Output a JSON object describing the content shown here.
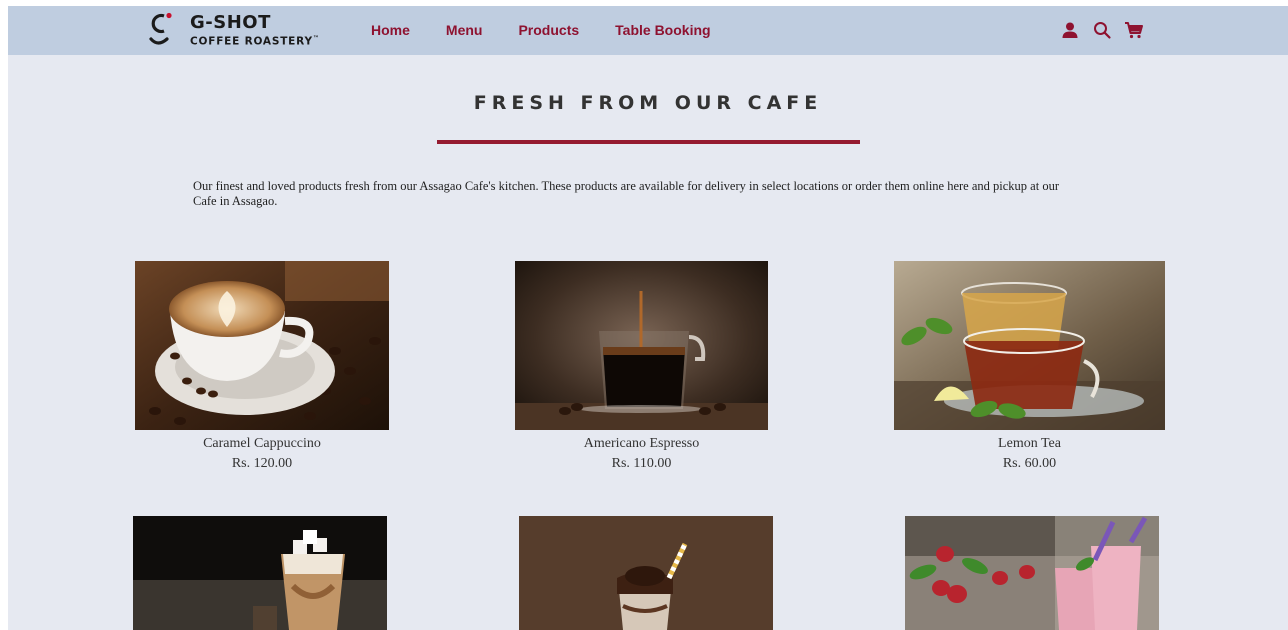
{
  "brand": {
    "name_line1": "G-SHOT",
    "name_line2": "COFFEE ROASTERY",
    "trademark": "™"
  },
  "nav": {
    "links": [
      "Home",
      "Menu",
      "Products",
      "Table Booking"
    ],
    "icons": [
      "user-icon",
      "search-icon",
      "cart-icon"
    ]
  },
  "section": {
    "title": "FRESH FROM OUR CAFE",
    "intro": "Our finest and loved products fresh from our Assagao Cafe's kitchen. These products are available for delivery in select locations or order them online here and pickup at our Cafe in Assagao."
  },
  "products": [
    {
      "name": "Caramel Cappuccino",
      "price": "Rs. 120.00"
    },
    {
      "name": "Americano Espresso",
      "price": "Rs. 110.00"
    },
    {
      "name": "Lemon Tea",
      "price": "Rs. 60.00"
    },
    {
      "name": "",
      "price": ""
    },
    {
      "name": "",
      "price": ""
    },
    {
      "name": "",
      "price": ""
    }
  ],
  "colors": {
    "navbar_bg": "#bfcde0",
    "page_bg": "#e6e9f1",
    "accent": "#951b30",
    "nav_link": "#8e1230"
  }
}
